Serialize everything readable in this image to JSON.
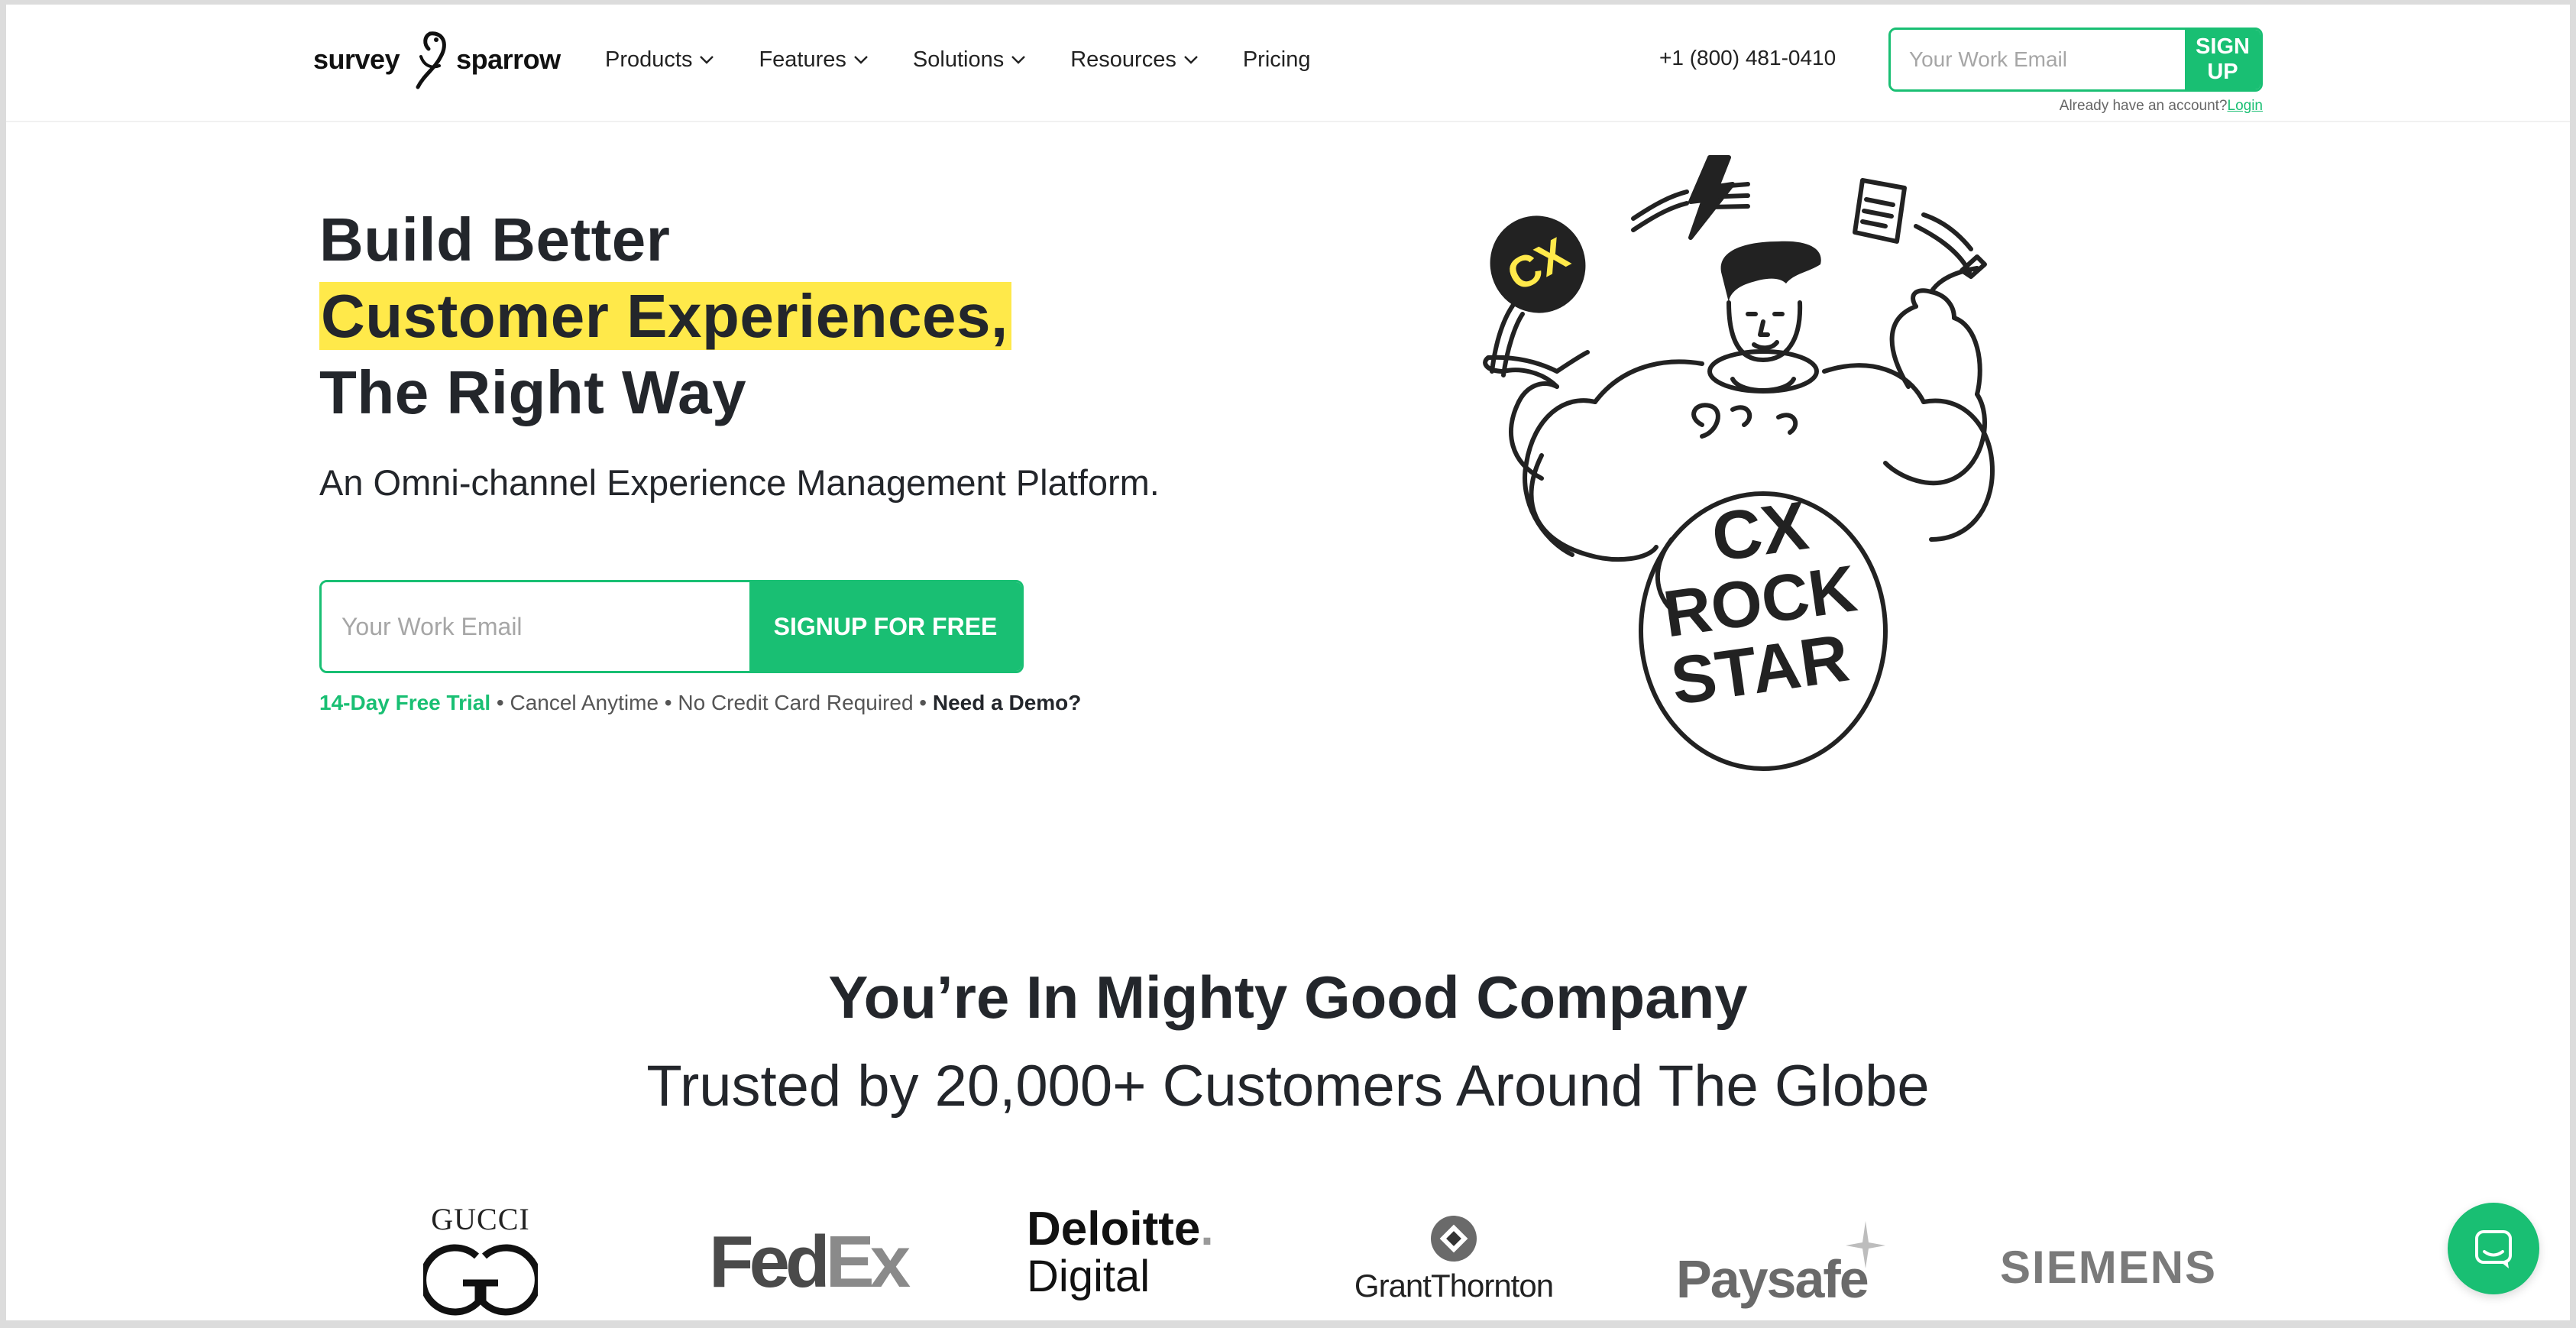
{
  "brand": {
    "logo_left": "survey",
    "logo_right": "sparrow",
    "accent_color": "#19bf73",
    "highlight_color": "#ffe94a"
  },
  "nav": {
    "items": [
      {
        "label": "Products",
        "has_dropdown": true
      },
      {
        "label": "Features",
        "has_dropdown": true
      },
      {
        "label": "Solutions",
        "has_dropdown": true
      },
      {
        "label": "Resources",
        "has_dropdown": true
      },
      {
        "label": "Pricing",
        "has_dropdown": false
      }
    ],
    "phone": "+1 (800) 481-0410",
    "email_placeholder": "Your Work Email",
    "signup_label": "SIGN UP",
    "account_prompt": "Already have an account?",
    "login_label": "Login"
  },
  "hero": {
    "title_line1": "Build Better",
    "title_line2": "Customer Experiences,",
    "title_line3": "The Right Way",
    "subtitle": "An Omni-channel Experience Management Platform.",
    "email_placeholder": "Your Work Email",
    "cta_label": "SIGNUP FOR FREE",
    "trial_label": "14-Day Free Trial",
    "sep1": " • Cancel Anytime • No Credit Card Required • ",
    "demo_label": "Need a Demo?",
    "illustration_text": [
      "CX",
      "ROCK",
      "STAR"
    ],
    "badge_text": "CX"
  },
  "social_proof": {
    "title": "You’re In Mighty Good Company",
    "subtitle": "Trusted by 20,000+ Customers Around The Globe",
    "logos": [
      {
        "name": "GUCCI",
        "icon": "gucci-gg-icon"
      },
      {
        "name_a": "Fed",
        "name_b": "Ex"
      },
      {
        "name_a": "Deloitte",
        "name_b": "Digital"
      },
      {
        "name": "GrantThornton",
        "icon": "grant-thornton-icon"
      },
      {
        "name": "Paysafe",
        "icon": "paysafe-star-icon"
      },
      {
        "name": "SIEMENS"
      }
    ]
  },
  "chat": {
    "icon": "chat-bubble-icon"
  }
}
